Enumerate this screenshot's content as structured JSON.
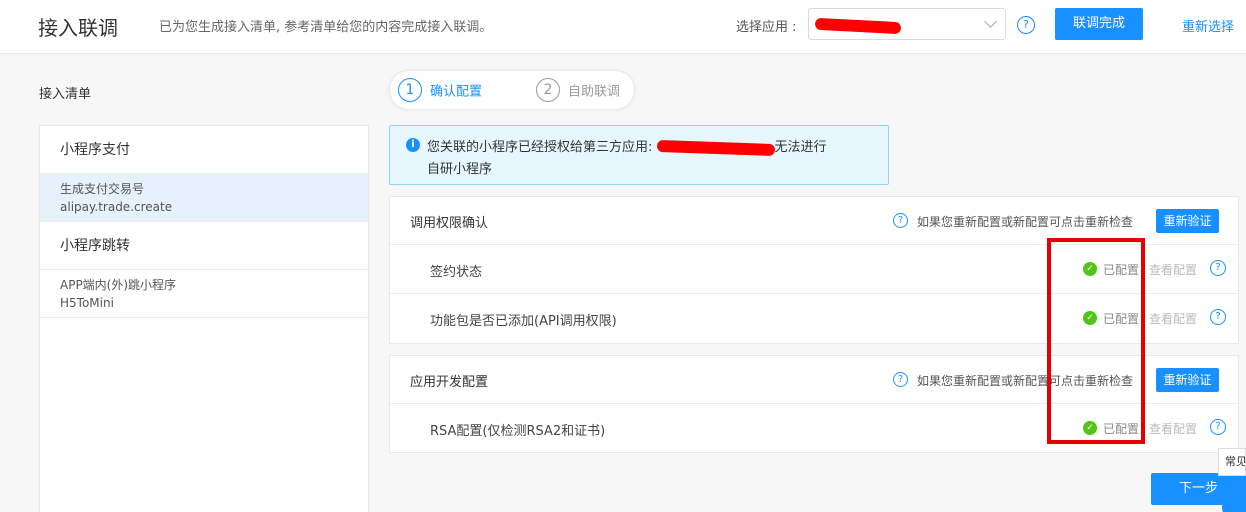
{
  "header": {
    "title": "接入联调",
    "description": "已为您生成接入清单, 参考清单给您的内容完成接入联调。",
    "select_label": "选择应用 :",
    "select_value": "",
    "help_icon": "question-circle-icon",
    "complete_button": "联调完成",
    "reselect_link": "重新选择"
  },
  "sidebar": {
    "title": "接入清单",
    "groups": [
      {
        "label": "小程序支付",
        "items": [
          {
            "name": "生成支付交易号",
            "api": "alipay.trade.create",
            "active": true
          }
        ]
      },
      {
        "label": "小程序跳转",
        "items": [
          {
            "name": "APP端内(外)跳小程序",
            "api": "H5ToMini",
            "active": false
          }
        ]
      }
    ]
  },
  "steps": [
    {
      "number": "1",
      "label": "确认配置",
      "active": true
    },
    {
      "number": "2",
      "label": "自助联调",
      "active": false
    }
  ],
  "info": {
    "icon": "info-circle-icon",
    "text_before": "您关联的小程序已经授权给第三方应用:",
    "text_after": "无法进行",
    "text_line2": "自研小程序"
  },
  "panels": [
    {
      "title": "调用权限确认",
      "tip": "如果您重新配置或新配置可点击重新检查",
      "button": "重新验证",
      "rows": [
        {
          "label": "签约状态",
          "status": "已配置",
          "view": "查看配置"
        },
        {
          "label": "功能包是否已添加(API调用权限)",
          "status": "已配置",
          "view": "查看配置"
        }
      ]
    },
    {
      "title": "应用开发配置",
      "tip": "如果您重新配置或新配置可点击重新检查",
      "button": "重新验证",
      "rows": [
        {
          "label": "RSA配置(仅检测RSA2和证书)",
          "status": "已配置",
          "view": "查看配置"
        }
      ]
    }
  ],
  "footer": {
    "next_button": "下一步",
    "float_tab": "常见"
  },
  "colors": {
    "primary": "#1890ff",
    "success": "#52c41a",
    "highlight": "#e60000",
    "info_bg": "#e6f7ff"
  }
}
